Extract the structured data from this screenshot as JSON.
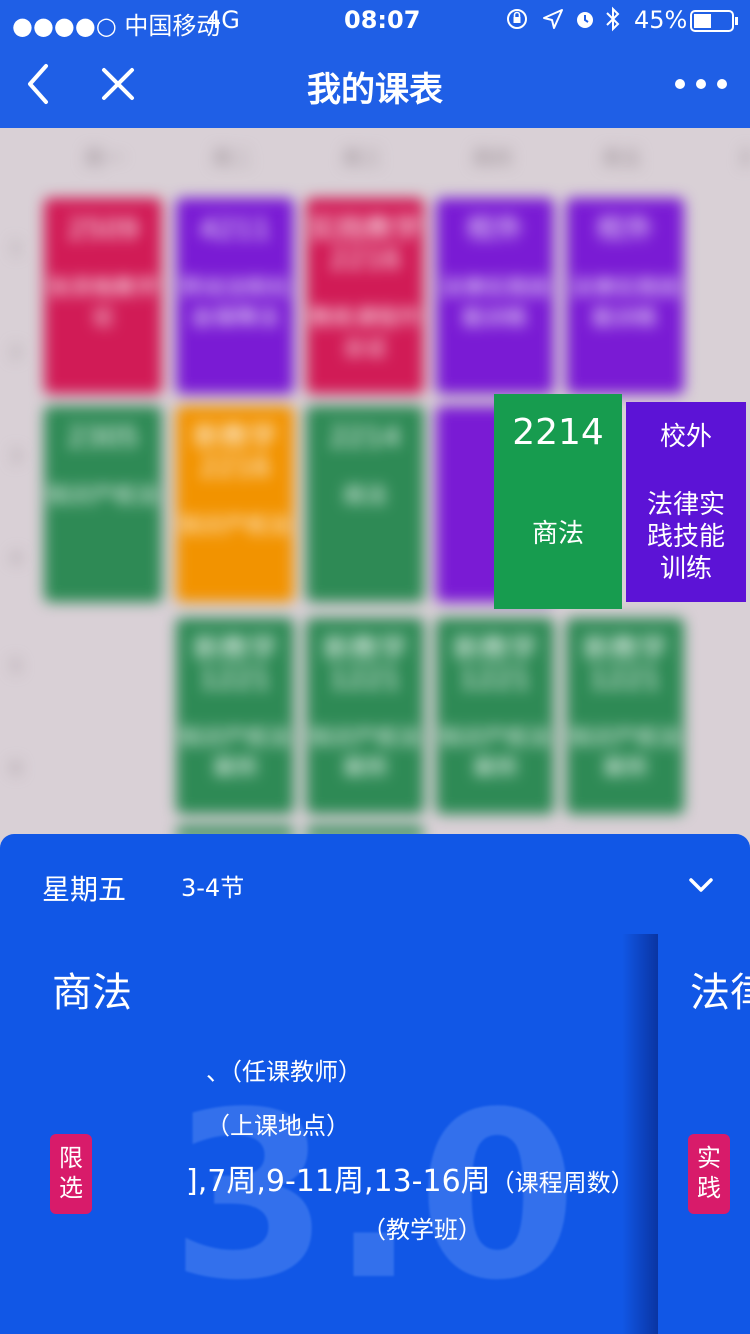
{
  "status_bar": {
    "carrier": "●●●●○ 中国移动",
    "network": "4G",
    "time": "08:07",
    "battery": "45%"
  },
  "nav": {
    "title": "我的课表",
    "back_icon": "chevron-left-icon",
    "close_icon": "close-icon",
    "more_icon": "more-icon"
  },
  "schedule": {
    "days": [
      "周一",
      "周二",
      "周三",
      "周四",
      "周五",
      "周"
    ],
    "periods": [
      "1",
      "2",
      "3",
      "4",
      "5",
      "6"
    ],
    "colors": {
      "crimson": "#d11b56",
      "purple": "#7a1bd4",
      "green": "#2e8a55",
      "orange": "#f29300"
    },
    "cards": [
      {
        "room": "2509",
        "text": "张资格教学论"
      },
      {
        "room": "4211",
        "text": "劳动法和社会保障法"
      },
      {
        "room": "实践教学2216",
        "text": "教练课程作业证"
      },
      {
        "room": "校外",
        "text": "法律实践技能训练"
      },
      {
        "room": "校外",
        "text": "法律实践技能训练"
      },
      {
        "room": "2305",
        "text": "知识产权法"
      },
      {
        "room": "新教学2216",
        "text": "知识产权法"
      },
      {
        "room": "2214",
        "text": "商法"
      },
      {
        "room": "新教学1221",
        "text": "知识产权法案例"
      },
      {
        "room": "新教学1221",
        "text": "知识产权法案例"
      },
      {
        "room": "新教学1221",
        "text": "知识产权法案例"
      },
      {
        "room": "新教学1221",
        "text": "知识产权法案例"
      }
    ]
  },
  "popup": {
    "selected": {
      "room": "2214",
      "name": "商法",
      "color": "#179c4f"
    },
    "other": {
      "room": "校外",
      "name": "法律实践技能训练",
      "color": "#5c13d6"
    }
  },
  "sheet": {
    "day": "星期五",
    "period": "3-4节",
    "course": "商法",
    "badge": "限选",
    "teacher_label": "（任课教师）",
    "location_label": "（上课地点）",
    "weeks": "],7周,9-11周,13-16周",
    "weeks_label": "（课程周数）",
    "class_label": "（教学班）",
    "teacher_fragment": "、",
    "next_course": "法律",
    "next_badge": "实践",
    "chevron_icon": "chevron-down-icon",
    "watermark": "3.0"
  }
}
